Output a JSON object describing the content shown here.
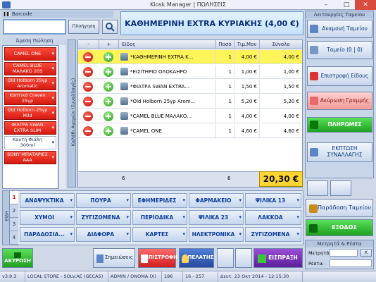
{
  "window": {
    "title": "Kiosk Manager | ΠΩΛΗΣΕΙΣ",
    "min": "–",
    "max": "□",
    "close": "✕"
  },
  "barcode": {
    "label": "Barcode",
    "value": ""
  },
  "search_button_label": "Πλοήγηση",
  "header_title": "ΚΑΘΗΜΕΡΙΝΗ EXTRA ΚΥΡΙΑΚΗΣ  (4,00 €)",
  "quick_sale": {
    "label": "Άμεση Πώληση",
    "items": [
      "CAMEL ONE",
      "CAMEL BLUE ΜΑΛΑΚΟ 20S",
      "Old Holborn 25γρ Aromatic",
      "Κοπτικό Craven 25γρ",
      "Old Holborn 25γρ Mild",
      "ΦΙΛΤΡΑ SWAN EXTRA SLIM",
      "Καυτή Φιάλη 300ml",
      "SONY ΜΠΑΤΑΡΙΕΣ ΑΑΑ"
    ]
  },
  "vertical_tab_label": "Καλάθι Αγορών (Συναλλαγές)",
  "grid": {
    "headers": {
      "minus": "-",
      "plus": "+",
      "item": "Είδος",
      "qty": "Ποσό",
      "price": "Τιμ.Μον",
      "total": "Σύνολο"
    },
    "rows": [
      {
        "name": "*ΚΑΘΗΜΕΡΙΝΗ EXTRA K...",
        "qty": "1",
        "price": "4,00 €",
        "total": "4,00 €",
        "selected": true
      },
      {
        "name": "*ΕΙΣΙΤΗΡΙΟ ΟΛΟΚΑΗΡΟ",
        "qty": "1",
        "price": "1,00 €",
        "total": "1,00 €"
      },
      {
        "name": "*ΦΙΑΤΡΑ SWAN EXTRA...",
        "qty": "1",
        "price": "1,50 €",
        "total": "1,50 €"
      },
      {
        "name": "*Old Holborn 25γρ Arom...",
        "qty": "1",
        "price": "5,20 €",
        "total": "5,20 €"
      },
      {
        "name": "*CAMEL BLUE ΜΑΛΑΚΟ...",
        "qty": "1",
        "price": "4,00 €",
        "total": "4,00 €"
      },
      {
        "name": "*CAMEL ONE",
        "qty": "1",
        "price": "4,60 €",
        "total": "4,60 €"
      }
    ],
    "footer_count": "6",
    "footer_qty": "6",
    "grand_total": "20,30 €"
  },
  "right_panel": {
    "title": "Λειτουργίες Ταμείου",
    "search_customer": "Αναμονή Ταμείου",
    "cash_register": "Ταμείο (0 | 0)",
    "return_item": "Επιστροφή Είδους",
    "cancel_line": "Ακύρωση Γραμμής",
    "payments": "ΠΛΗΡΩΜΕΣ",
    "discount": "ΕΚΠΤΩΣΗ ΣΥΝΑΛΛΑΓΗΣ",
    "tax_label": "Παράδοση Ταμείου",
    "exit": "ΕΞΟΔΟΣ"
  },
  "categories": {
    "side_label": "ΕΙΔΗ",
    "tabs": [
      "1",
      "2",
      "3",
      "4"
    ],
    "row1": [
      "ΑΝΑΨΥΚΤΙΚΑ",
      "ΠΟΥΡΑ",
      "ΕΦΗΜΕΡΙΔΕΣ",
      "ΦΑΡΜΑΚΕΙΟ",
      "ΨΙΛΙΚΑ 13"
    ],
    "row2": [
      "ΧΥΜΟΙ",
      "ΖΥΓΙΖΟΜΕΝΑ",
      "ΠΕΡΙΟΔΙΚΑ",
      "ΨΙΛΙΚΑ 23",
      "ΛΑΚΚΟΑ"
    ],
    "row3": [
      "ΠΑΡΑΔΟΣΙΑ...",
      "ΔΙΑΦΟΡΑ",
      "ΚΑΡΤΕΣ",
      "ΗΛΕΚΤΡΟΝΙΚΑ",
      "ΖΥΓΙΖΟΜΕΝΑ"
    ]
  },
  "bottom": {
    "cancel": "ΑΚΥΡΩΣΗ",
    "notes": "Σημειώσεις",
    "returns": "ΕΠΙΣΤΡΟΦΗ",
    "customer": "ΠΕΛΑΤΗΣ",
    "receipt": "ΕΙΣΠΡΑΞΗ"
  },
  "calc": {
    "title": "Μετρητά & Ρέστα",
    "cash_label": "Μετρητά:",
    "change_label": "Ρέστα:",
    "ok": "K"
  },
  "status": {
    "version": "v3.9.3",
    "store": "LOCAL STORE - SOLV.AE (GECAS)",
    "user": "ADMIN / ONOMA (X)",
    "f1": "186",
    "f2": "16 - 257",
    "date": "Δευτ. 23 Οκτ 2014 - 12:15:30"
  }
}
